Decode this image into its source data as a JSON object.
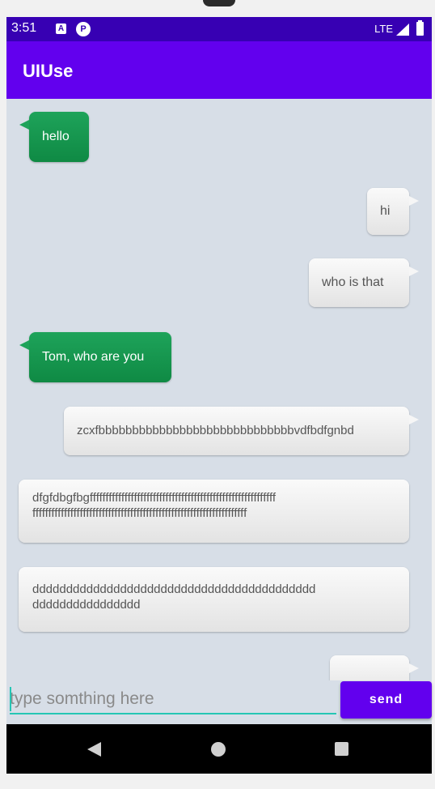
{
  "status": {
    "time": "3:51",
    "a_icon": "A",
    "p_icon": "P",
    "network": "LTE"
  },
  "appbar": {
    "title": "UIUse"
  },
  "messages": [
    {
      "type": "received",
      "text": "hello"
    },
    {
      "type": "sent",
      "text": "hi"
    },
    {
      "type": "sent",
      "text": "who is that"
    },
    {
      "type": "received",
      "text": "Tom, who are you"
    },
    {
      "type": "sent",
      "text": "zcxfbbbbbbbbbbbbbbbbbbbbbbbbbbbbbvdfbdfgnbd"
    },
    {
      "type": "sent",
      "lines": [
        "dfgfdbgfbgfffffffffffffffffffffffffffffffffffffffffffffffffffffffffff",
        "ffffffffffffffffffffffffffffffffffffffffffffffffffffffffffffffffffff"
      ]
    },
    {
      "type": "sent",
      "lines": [
        "dddddddddddddddddddddddddddddddddddddddddd",
        "dddddddddddddddd"
      ]
    },
    {
      "type": "sent",
      "text": ""
    }
  ],
  "input": {
    "placeholder": "type somthing here",
    "value": ""
  },
  "send_button": {
    "label": "send"
  },
  "colors": {
    "primary": "#6200ee",
    "primary_dark": "#3700b3",
    "accent": "#26c6b4",
    "received_bubble": "#1ea35a",
    "chat_bg": "#d7dee7"
  }
}
